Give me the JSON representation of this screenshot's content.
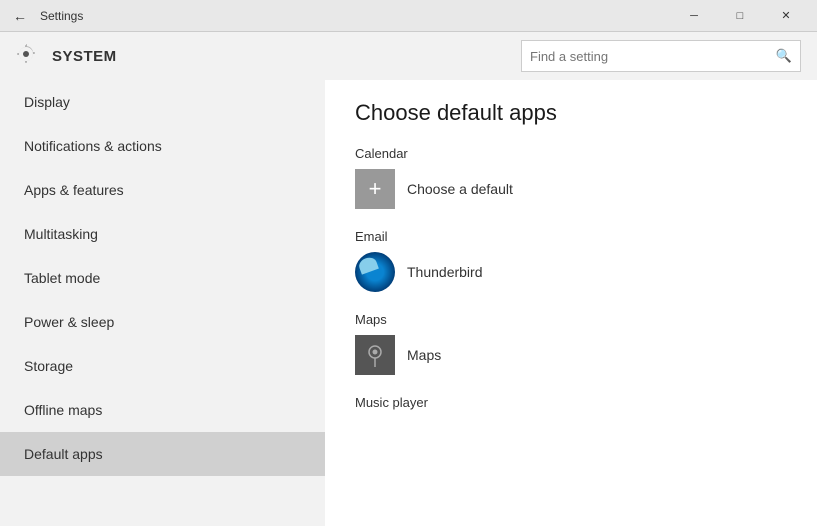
{
  "titlebar": {
    "title": "Settings",
    "minimize_label": "─",
    "maximize_label": "□",
    "close_label": "✕"
  },
  "header": {
    "title": "SYSTEM",
    "search_placeholder": "Find a setting"
  },
  "sidebar": {
    "items": [
      {
        "id": "display",
        "label": "Display"
      },
      {
        "id": "notifications",
        "label": "Notifications & actions"
      },
      {
        "id": "apps-features",
        "label": "Apps & features"
      },
      {
        "id": "multitasking",
        "label": "Multitasking"
      },
      {
        "id": "tablet-mode",
        "label": "Tablet mode"
      },
      {
        "id": "power-sleep",
        "label": "Power & sleep"
      },
      {
        "id": "storage",
        "label": "Storage"
      },
      {
        "id": "offline-maps",
        "label": "Offline maps"
      },
      {
        "id": "default-apps",
        "label": "Default apps",
        "active": true
      }
    ]
  },
  "content": {
    "page_title": "Choose default apps",
    "sections": [
      {
        "id": "calendar",
        "label": "Calendar",
        "app": {
          "name": "Choose a default",
          "icon_type": "plus"
        }
      },
      {
        "id": "email",
        "label": "Email",
        "app": {
          "name": "Thunderbird",
          "icon_type": "thunderbird"
        }
      },
      {
        "id": "maps",
        "label": "Maps",
        "app": {
          "name": "Maps",
          "icon_type": "maps"
        }
      },
      {
        "id": "music-player",
        "label": "Music player",
        "app": {
          "name": null,
          "icon_type": null
        }
      }
    ]
  }
}
